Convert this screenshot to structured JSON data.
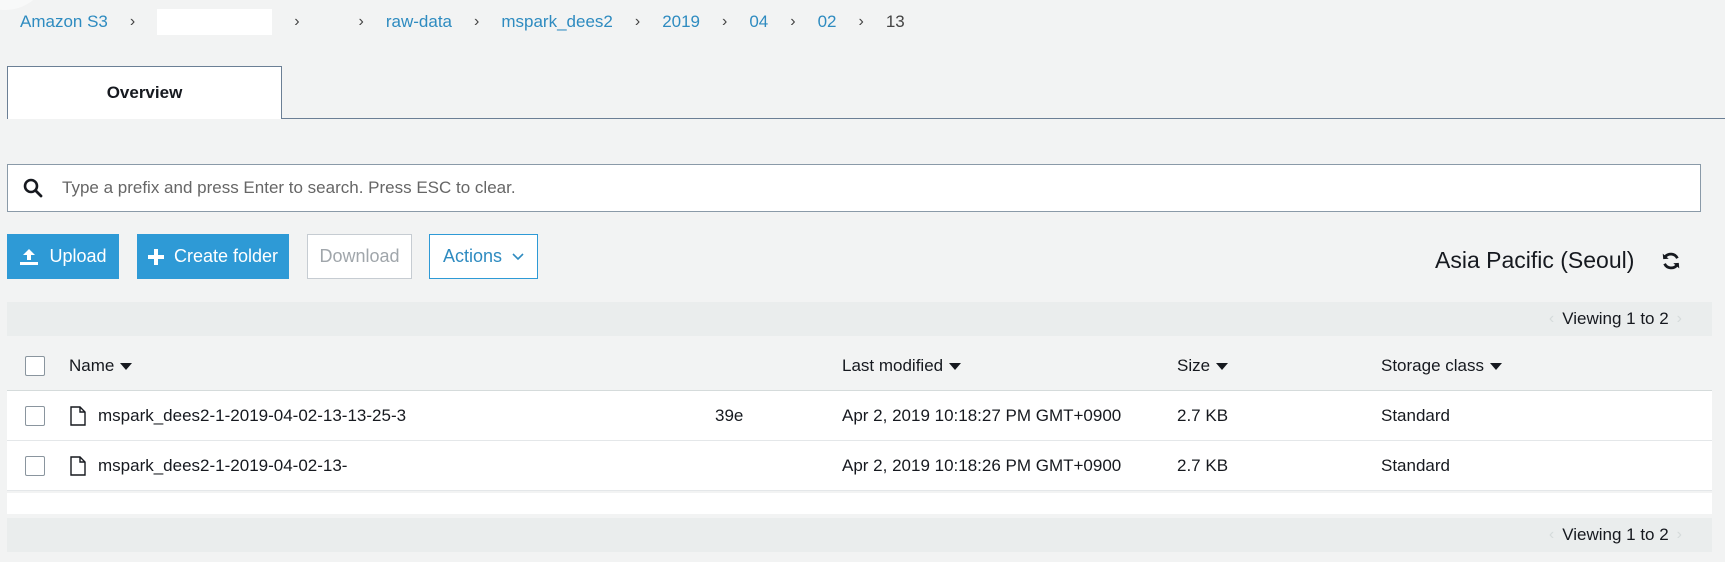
{
  "breadcrumb": {
    "root": "Amazon S3",
    "items": [
      "raw-data",
      "mspark_dees2",
      "2019",
      "04",
      "02"
    ],
    "current": "13",
    "separator": "›"
  },
  "tabs": {
    "overview": "Overview"
  },
  "search": {
    "placeholder": "Type a prefix and press Enter to search. Press ESC to clear.",
    "value": ""
  },
  "toolbar": {
    "upload_label": "Upload",
    "create_folder_label": "Create folder",
    "download_label": "Download",
    "actions_label": "Actions",
    "region": "Asia Pacific (Seoul)"
  },
  "pager": {
    "top_text": "Viewing 1 to 2",
    "bottom_text": "Viewing 1 to 2",
    "prev": "‹",
    "next": "›"
  },
  "table": {
    "columns": {
      "name": "Name",
      "last_modified": "Last modified",
      "size": "Size",
      "storage_class": "Storage class"
    },
    "rows": [
      {
        "name": "mspark_dees2-1-2019-04-02-13-13-25-3",
        "name_tail": "39e",
        "last_modified": "Apr 2, 2019 10:18:27 PM GMT+0900",
        "size": "2.7 KB",
        "storage_class": "Standard"
      },
      {
        "name": "mspark_dees2-1-2019-04-02-13-",
        "name_tail": "",
        "last_modified": "Apr 2, 2019 10:18:26 PM GMT+0900",
        "size": "2.7 KB",
        "storage_class": "Standard"
      }
    ]
  },
  "colors": {
    "link": "#2e8bc0",
    "primary": "#2e9ad6",
    "background": "#f2f3f3"
  },
  "icons": [
    "search-icon",
    "upload-icon",
    "plus-icon",
    "chevron-down-icon",
    "refresh-icon",
    "file-icon",
    "sort-caret-icon"
  ]
}
